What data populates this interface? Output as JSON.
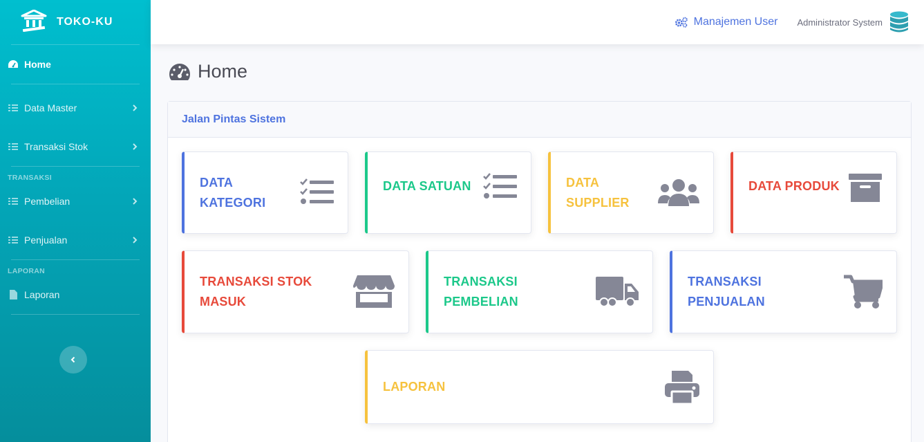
{
  "brand": {
    "name": "TOKO-KU",
    "icon": "university-icon"
  },
  "sidebar": {
    "items": [
      {
        "label": "Home",
        "icon": "tachometer-icon"
      },
      {
        "label": "Data Master",
        "icon": "list-check-icon"
      },
      {
        "label": "Transaksi Stok",
        "icon": "list-check-icon"
      },
      {
        "label": "Pembelian",
        "icon": "list-check-icon"
      },
      {
        "label": "Penjualan",
        "icon": "list-check-icon"
      },
      {
        "label": "Laporan",
        "icon": "file-icon"
      }
    ],
    "headings": [
      "TRANSAKSI",
      "LAPORAN"
    ]
  },
  "topbar": {
    "manage_user_label": "Manajemen User",
    "user_name": "Administrator System"
  },
  "page": {
    "title": "Home"
  },
  "panel": {
    "title": "Jalan Pintas Sistem"
  },
  "cards": [
    {
      "title_line1": "DATA",
      "title_line2": "KATEGORI",
      "icon": "tasks-icon",
      "color": "#4e73df"
    },
    {
      "title_line1": "DATA SATUAN",
      "title_line2": "",
      "icon": "tasks-icon",
      "color": "#1cc88a"
    },
    {
      "title_line1": "DATA",
      "title_line2": "SUPPLIER",
      "icon": "users-icon",
      "color": "#f6c23e"
    },
    {
      "title_line1": "DATA PRODUK",
      "title_line2": "",
      "icon": "archive-icon",
      "color": "#e74a3b"
    },
    {
      "title_line1": "TRANSAKSI STOK",
      "title_line2": "MASUK",
      "icon": "store-icon",
      "color": "#e74a3b"
    },
    {
      "title_line1": "TRANSAKSI",
      "title_line2": "PEMBELIAN",
      "icon": "truck-icon",
      "color": "#1cc88a"
    },
    {
      "title_line1": "TRANSAKSI",
      "title_line2": "PENJUALAN",
      "icon": "shopping-cart-icon",
      "color": "#4e73df"
    },
    {
      "title_line1": "LAPORAN",
      "title_line2": "",
      "icon": "print-icon",
      "color": "#f6c23e"
    }
  ],
  "colors": {
    "sidebar_top": "#00bfcf",
    "sidebar_bottom": "#058e9c",
    "primary": "#4e73df",
    "icon_gray": "#858796"
  }
}
